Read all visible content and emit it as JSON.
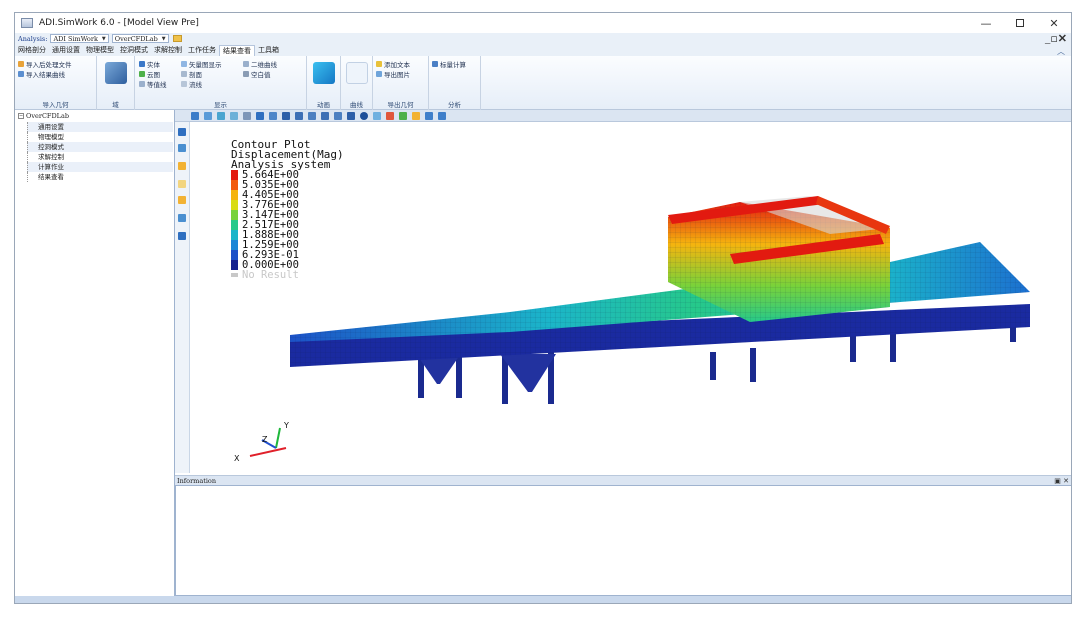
{
  "window": {
    "title": "ADI.SimWork 6.0 - [Model View Pre]",
    "controls": {
      "minimize": "—",
      "maximize": "",
      "close": "✕"
    },
    "mdi_controls": "_▫✕"
  },
  "analysis_bar": {
    "label": "Analysis:",
    "analysis_value": "ADI SimWork",
    "project_value": "OverCFDLab"
  },
  "tabs": [
    {
      "label": "网格剖分",
      "active": false
    },
    {
      "label": "通用设置",
      "active": false
    },
    {
      "label": "物理模型",
      "active": false
    },
    {
      "label": "控洞模式",
      "active": false
    },
    {
      "label": "求解控制",
      "active": false
    },
    {
      "label": "工作任务",
      "active": false
    },
    {
      "label": "结果查看",
      "active": true
    },
    {
      "label": "工具箱",
      "active": false
    }
  ],
  "ribbon": {
    "import_group": {
      "label": "导入几何",
      "items": [
        "导入后处理文件",
        "导入结果曲线"
      ]
    },
    "domain_group": {
      "label": "域"
    },
    "display_group": {
      "label": "显示",
      "items_col1": [
        "实体",
        "云图",
        "等值线"
      ],
      "items_col2": [
        "矢量图显示",
        "剖面",
        "流线"
      ],
      "items_col3": [
        "二维曲线",
        "空白值"
      ]
    },
    "animation_group": {
      "label": "动画"
    },
    "curve_group": {
      "label": "曲线"
    },
    "export_group": {
      "label": "导出几何",
      "items": [
        "添加文本",
        "导出图片"
      ]
    },
    "analysis_group": {
      "label": "分析",
      "items": [
        "标量计算"
      ]
    }
  },
  "tree": {
    "root": "OverCFDLab",
    "items": [
      "通用设置",
      "物理模型",
      "控洞模式",
      "求解控制",
      "计算作业",
      "结果查看"
    ]
  },
  "legend": {
    "title_lines": [
      "Contour Plot",
      "Displacement(Mag)",
      "Analysis system"
    ],
    "entries": [
      {
        "value": "5.664E+00",
        "color": "#e21a10"
      },
      {
        "value": "5.035E+00",
        "color": "#f25a0c"
      },
      {
        "value": "4.405E+00",
        "color": "#f5b40e"
      },
      {
        "value": "3.776E+00",
        "color": "#d9dc14"
      },
      {
        "value": "3.147E+00",
        "color": "#78d23a"
      },
      {
        "value": "2.517E+00",
        "color": "#26c98a"
      },
      {
        "value": "1.888E+00",
        "color": "#1bb5c9"
      },
      {
        "value": "1.259E+00",
        "color": "#1b86d6"
      },
      {
        "value": "6.293E-01",
        "color": "#1c52c8"
      },
      {
        "value": "0.000E+00",
        "color": "#15228f"
      }
    ],
    "no_result": "No Result"
  },
  "axes": {
    "x": "X",
    "y": "Y",
    "z": "Z"
  },
  "info_panel": {
    "title": "Information",
    "controls": "▣ ✕"
  }
}
